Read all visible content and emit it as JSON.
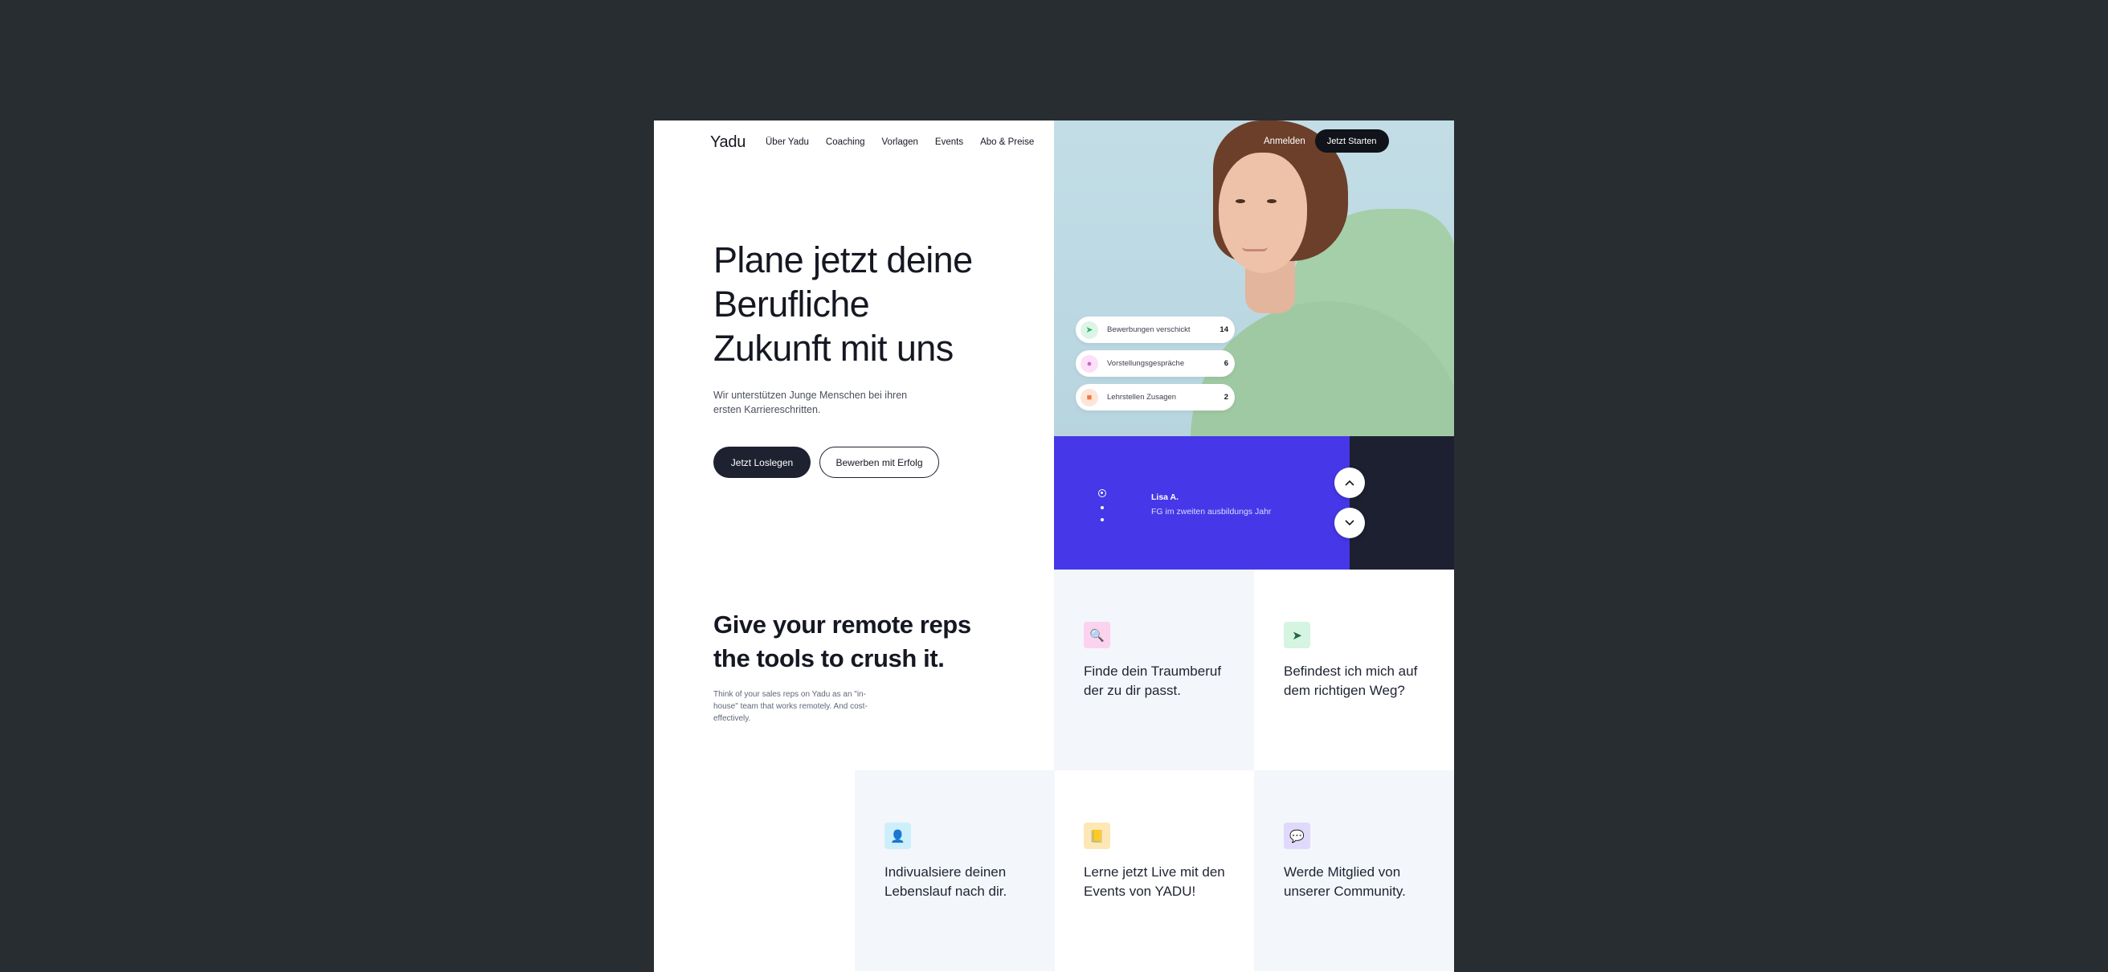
{
  "header": {
    "logo": "Yadu",
    "nav": [
      "Über Yadu",
      "Coaching",
      "Vorlagen",
      "Events",
      "Abo & Preise"
    ],
    "login": "Anmelden",
    "start": "Jetzt Starten"
  },
  "hero": {
    "title": "Plane jetzt deine Berufliche Zukunft mit uns",
    "subtitle": "Wir unterstützen Junge Menschen bei ihren ersten Karriereschritten.",
    "primary_button": "Jetzt Loslegen",
    "secondary_button": "Bewerben mit Erfolg"
  },
  "stats": [
    {
      "icon": "paper-plane-icon",
      "label": "Bewerbungen verschickt",
      "value": "14",
      "color": "#2fb36a",
      "bg": "#dcf5e6"
    },
    {
      "icon": "people-icon",
      "label": "Vorstellungsgespräche",
      "value": "6",
      "color": "#d55fc9",
      "bg": "#fbe0f7"
    },
    {
      "icon": "briefcase-icon",
      "label": "Lehrstellen Zusagen",
      "value": "2",
      "color": "#f07a3c",
      "bg": "#fde6d8"
    }
  ],
  "testimonial": {
    "name": "Lisa A.",
    "role": "FG im zweiten ausbildungs Jahr",
    "slide_count": 3,
    "active_slide": 1,
    "accent": "#4638e8"
  },
  "section": {
    "title": "Give your remote reps the tools to crush it.",
    "subtitle": "Think of your sales reps on Yadu as an \"in-house\" team that works remotely. And cost-effectively."
  },
  "features": [
    {
      "icon": "magnifier-icon",
      "glyph": "🔍",
      "bg": "#fbd3ee",
      "text": "Finde dein Traumberuf der zu dir passt."
    },
    {
      "icon": "signpost-icon",
      "glyph": "➤",
      "bg": "#d5f4e2",
      "text": "Befindest ich mich auf dem richtigen Weg?"
    },
    {
      "icon": "person-icon",
      "glyph": "👤",
      "bg": "#cdeffb",
      "text": "Indivualsiere deinen Lebenslauf nach dir."
    },
    {
      "icon": "notebook-icon",
      "glyph": "📒",
      "bg": "#fde7b4",
      "text": "Lerne jetzt Live mit den Events von YADU!"
    },
    {
      "icon": "chat-icon",
      "glyph": "💬",
      "bg": "#e0d9fb",
      "text": "Werde Mitglied von unserer Community."
    }
  ]
}
